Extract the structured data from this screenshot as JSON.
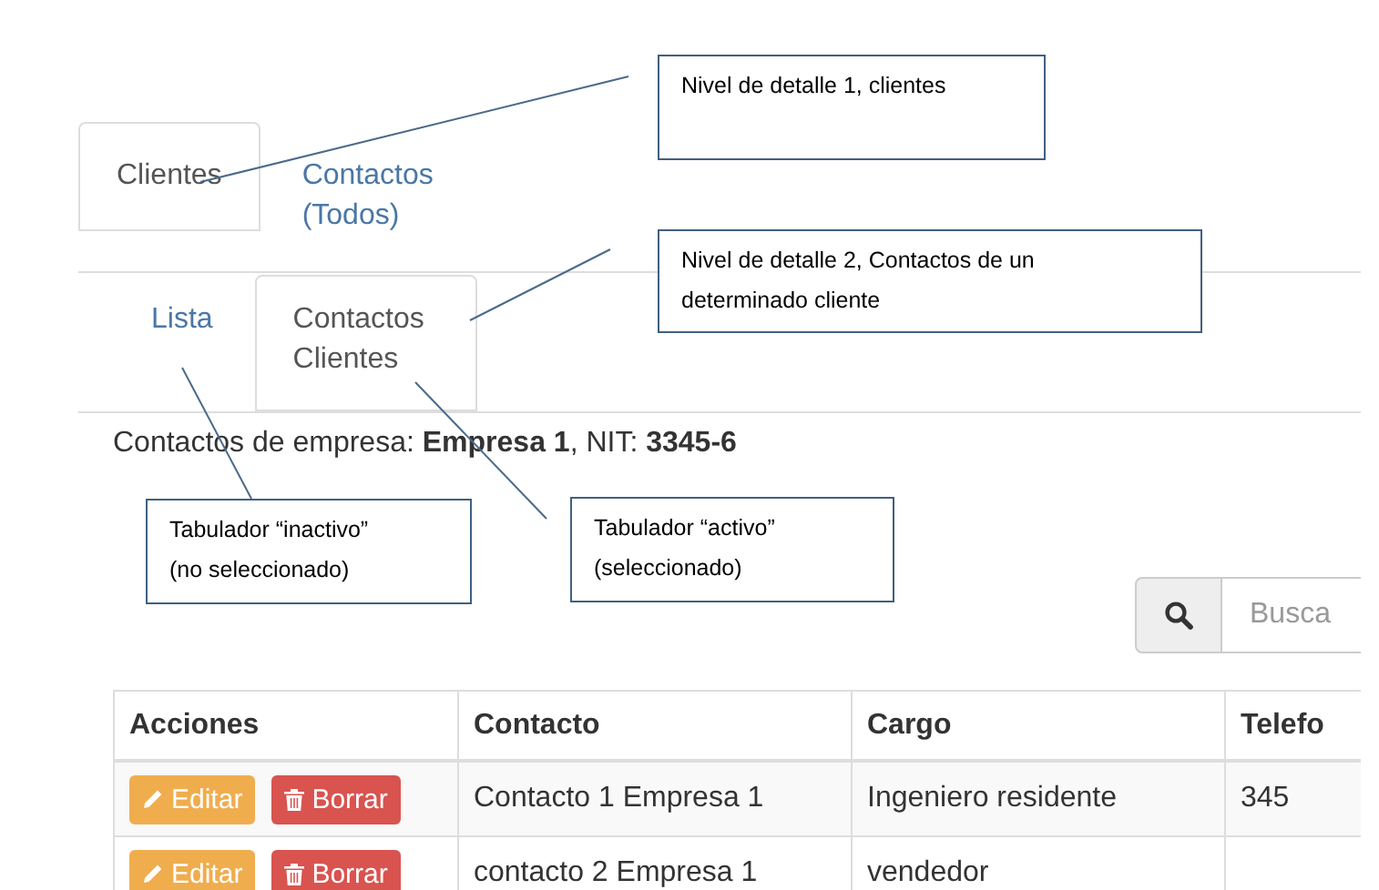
{
  "tabs_level1": [
    {
      "label": "Clientes",
      "selected": true
    },
    {
      "label": "Contactos (Todos)",
      "selected": false
    }
  ],
  "tabs_level2": [
    {
      "label": "Lista",
      "selected": false
    },
    {
      "label": "Contactos Clientes",
      "selected": true
    }
  ],
  "company_line": "Contactos de empresa: **Empresa 1**, NIT: **3345-6**",
  "search": {
    "placeholder": "Busca"
  },
  "table": {
    "columns": [
      "Acciones",
      "Contacto",
      "Cargo",
      "Telefo"
    ],
    "rows": [
      {
        "cells": [
          {
            "buttons": [
              {
                "label": "Editar",
                "kind": "edit"
              },
              {
                "label": "Borrar",
                "kind": "delete"
              }
            ]
          },
          "Contacto 1 Empresa 1",
          "Ingeniero residente",
          "345"
        ]
      },
      {
        "cells": [
          {
            "buttons": [
              {
                "label": "Editar",
                "kind": "edit"
              },
              {
                "label": "Borrar",
                "kind": "delete"
              }
            ]
          },
          "contacto 2 Empresa 1",
          "vendedor",
          ""
        ]
      }
    ]
  },
  "callouts": [
    {
      "text": "Nivel de detalle 1, clientes"
    },
    {
      "text": "Nivel de detalle 2, Contactos de un determinado cliente"
    },
    {
      "text": "Tabulador “inactivo” (no seleccionado)"
    },
    {
      "text": "Tabulador “activo” (seleccionado)"
    }
  ]
}
